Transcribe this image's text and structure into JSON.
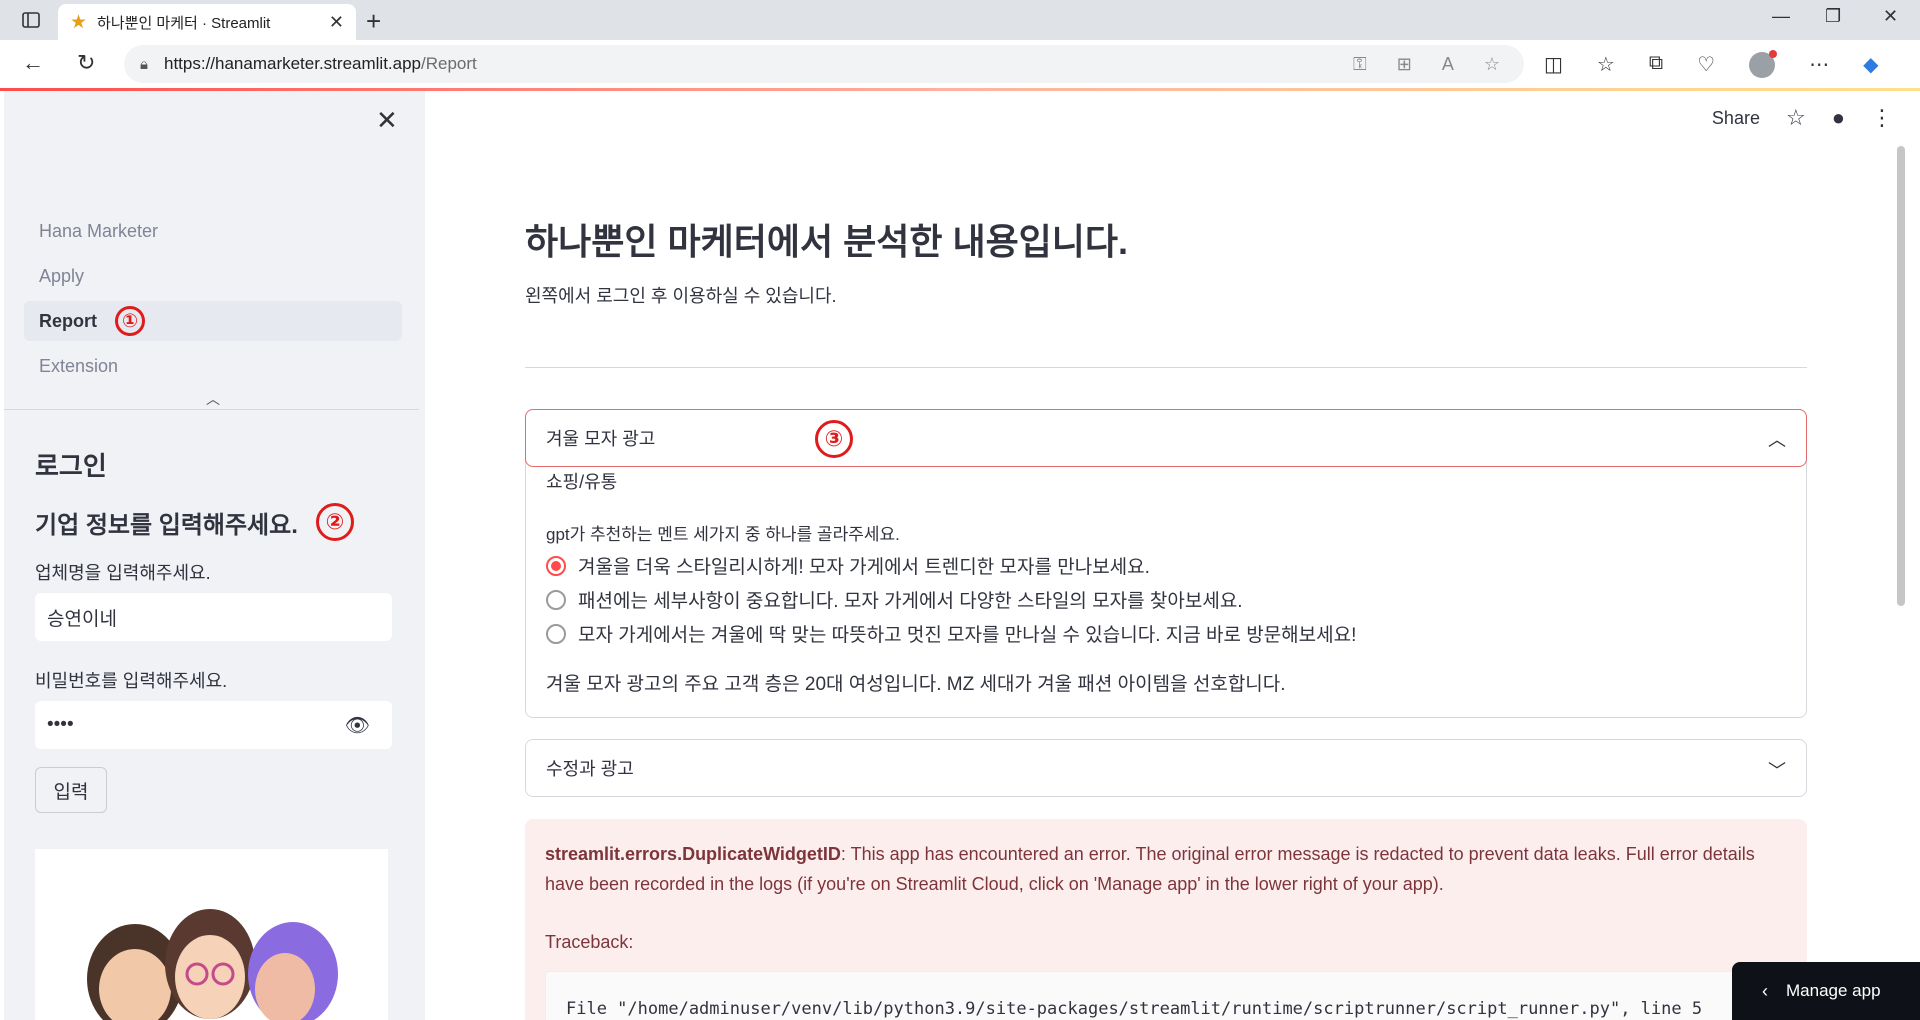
{
  "browser": {
    "tab_title": "하나뿐인 마케터 · Streamlit",
    "url_host": "https://hanamarketer.streamlit.app",
    "url_path": "/Report"
  },
  "sidebar": {
    "nav_items": [
      {
        "label": "Hana Marketer"
      },
      {
        "label": "Apply"
      },
      {
        "label": "Report",
        "badge": "①"
      },
      {
        "label": "Extension"
      }
    ],
    "login_heading": "로그인",
    "company_heading": "기업 정보를 입력해주세요.",
    "company_badge": "②",
    "company_label": "업체명을 입력해주세요.",
    "company_value": "승연이네",
    "password_label": "비밀번호를 입력해주세요.",
    "password_value": "••••",
    "submit_label": "입력"
  },
  "header": {
    "share_label": "Share"
  },
  "main": {
    "title": "하나뿐인 마케터에서 분석한 내용입니다.",
    "subtitle": "왼쪽에서 로그인 후 이용하실 수 있습니다.",
    "expander_open": {
      "title": "겨울 모자 광고",
      "badge": "③",
      "category": "쇼핑/유통",
      "radio_label": "gpt가 추천하는 멘트 세가지 중 하나를 골라주세요.",
      "options": [
        "겨울을 더욱 스타일리시하게! 모자 가게에서 트렌디한 모자를 만나보세요.",
        "패션에는 세부사항이 중요합니다. 모자 가게에서 다양한 스타일의 모자를 찾아보세요.",
        "모자 가게에서는 겨울에 딱 맞는 따뜻하고 멋진 모자를 만나실 수 있습니다. 지금 바로 방문해보세요!"
      ],
      "selected_index": 0,
      "summary": "겨울 모자 광고의 주요 고객 층은 20대 여성입니다. MZ 세대가 겨울 패션 아이템을 선호합니다."
    },
    "expander_closed": {
      "title": "수정과 광고"
    },
    "error": {
      "name": "streamlit.errors.DuplicateWidgetID",
      "message": ": This app has encountered an error. The original error message is redacted to prevent data leaks. Full error details have been recorded in the logs (if you're on Streamlit Cloud, click on 'Manage app' in the lower right of your app).",
      "traceback_label": "Traceback:",
      "code_line": "File \"/home/adminuser/venv/lib/python3.9/site-packages/streamlit/runtime/scriptrunner/script_runner.py\", line 5"
    }
  },
  "manage_app_label": "Manage app",
  "colors": {
    "accent": "#ff4b4b",
    "annotation_red": "#e01b1b",
    "sidebar_bg": "#f0f2f6",
    "error_bg": "#fdeeee"
  }
}
